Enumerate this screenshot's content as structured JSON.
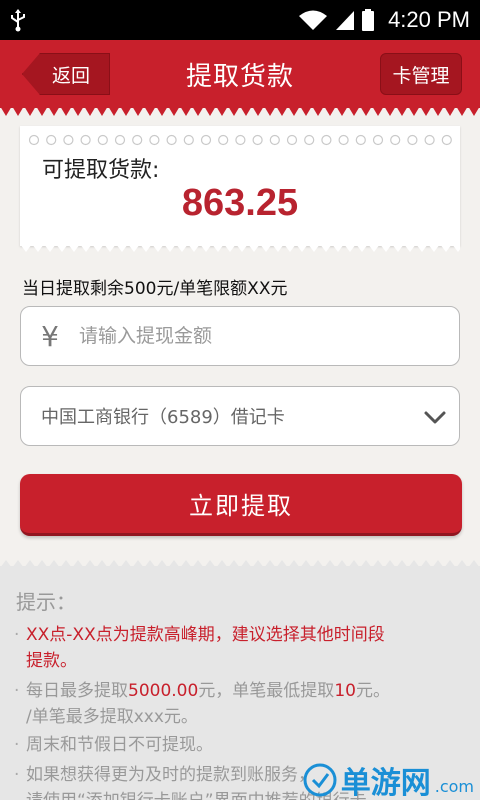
{
  "status_bar": {
    "time": "4:20 PM"
  },
  "header": {
    "back_label": "返回",
    "title": "提取货款",
    "card_manage_label": "卡管理"
  },
  "balance": {
    "label": "可提取货款:",
    "amount": "863.25"
  },
  "limit_text": "当日提取剩余500元/单笔限额XX元",
  "amount_input": {
    "currency_symbol": "¥",
    "placeholder": "请输入提现金额"
  },
  "bank_select": {
    "selected": "中国工商银行（6589）借记卡"
  },
  "submit_label": "立即提取",
  "tips": {
    "heading": "提示：",
    "tip1": {
      "line1": "XX点-XX点为提款高峰期，建议选择其他时间段",
      "line2": "提款。"
    },
    "tip2": {
      "a": "每日最多提取",
      "b": "5000.00",
      "c": "元，单笔最低提取",
      "d": "10",
      "e": "元。",
      "line2": "/单笔最多提取xxx元。"
    },
    "tip3": "周末和节假日不可提现。",
    "tip4": {
      "line1": "如果想获得更为及时的提款到账服务，",
      "line2": "请使用“添加银行卡账户”界面中推荐的银行卡"
    }
  },
  "watermark": {
    "text": "单游网",
    "domain": ".com"
  },
  "colors": {
    "brand_red": "#c8202c",
    "tip_gray": "#999999"
  }
}
